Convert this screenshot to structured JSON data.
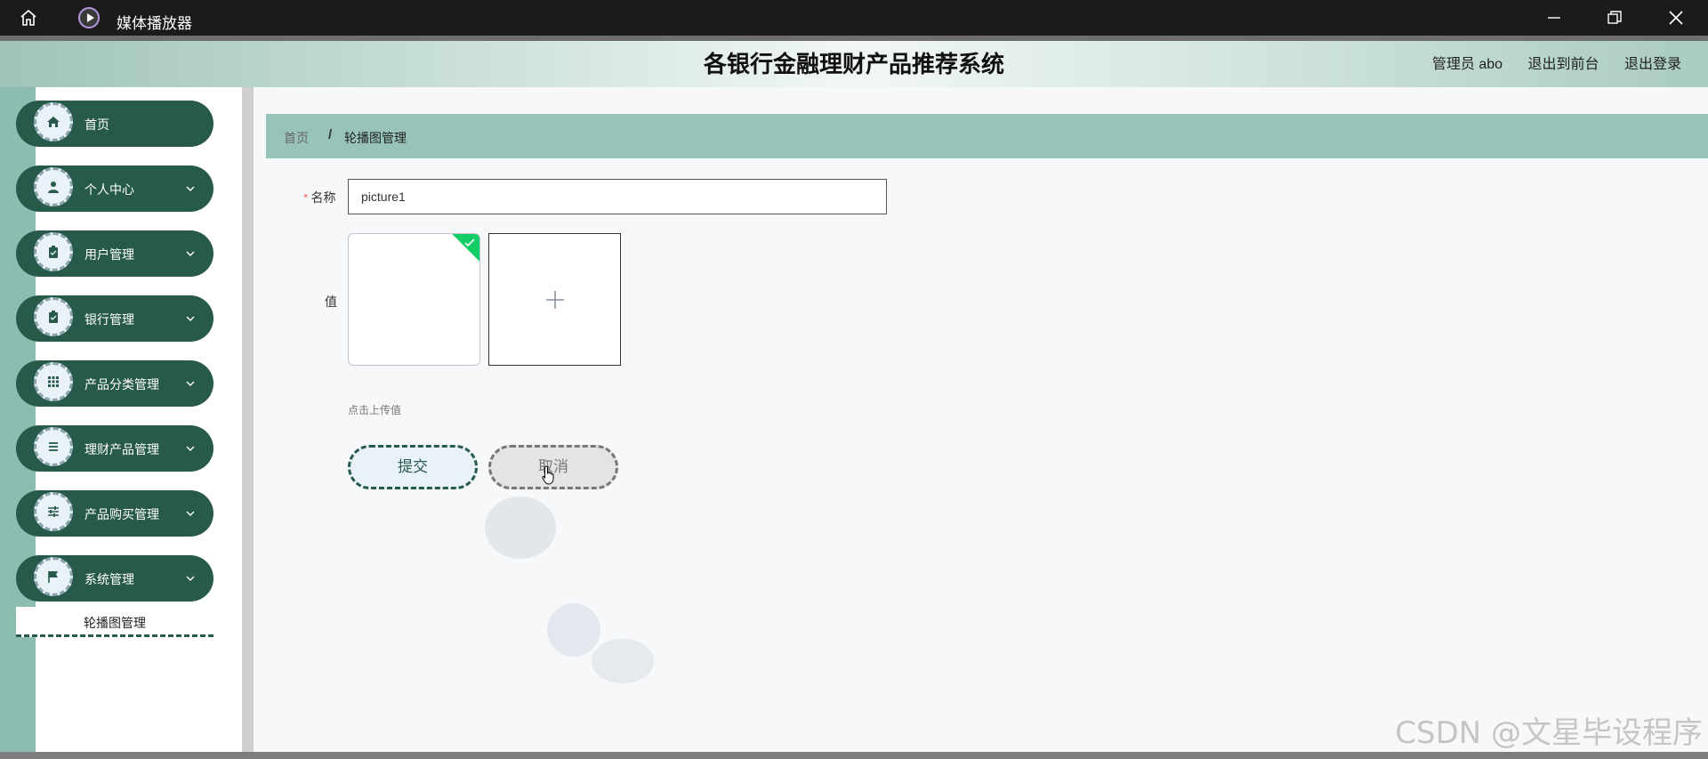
{
  "window": {
    "title": "媒体播放器",
    "icons": [
      "home-icon",
      "media-player-icon",
      "minimize-icon",
      "restore-icon",
      "close-icon"
    ]
  },
  "header": {
    "title": "各银行金融理财产品推荐系统",
    "user": "管理员 abo",
    "back_to_front": "退出到前台",
    "logout": "退出登录"
  },
  "sidebar": {
    "items": [
      {
        "label": "首页",
        "icon": "home-icon",
        "has_children": false
      },
      {
        "label": "个人中心",
        "icon": "user-icon",
        "has_children": true
      },
      {
        "label": "用户管理",
        "icon": "clipboard-icon",
        "has_children": true
      },
      {
        "label": "银行管理",
        "icon": "clipboard-check-icon",
        "has_children": true
      },
      {
        "label": "产品分类管理",
        "icon": "grid-icon",
        "has_children": true
      },
      {
        "label": "理财产品管理",
        "icon": "list-icon",
        "has_children": true
      },
      {
        "label": "产品购买管理",
        "icon": "sliders-icon",
        "has_children": true
      },
      {
        "label": "系统管理",
        "icon": "flag-icon",
        "has_children": true
      }
    ],
    "active_submenu": "轮播图管理"
  },
  "breadcrumb": {
    "home": "首页",
    "separator": "/",
    "current": "轮播图管理"
  },
  "form": {
    "required_mark": "*",
    "name_label": "名称",
    "name_value": "picture1",
    "value_label": "值",
    "upload_tip": "点击上传值",
    "submit": "提交",
    "cancel": "取消"
  },
  "watermark": "CSDN @文星毕设程序",
  "colors": {
    "sidebar_item": "#275a4b",
    "breadcrumb_bar": "#97c3b8",
    "upload_success": "#13ce66",
    "required": "#f56c6c"
  }
}
